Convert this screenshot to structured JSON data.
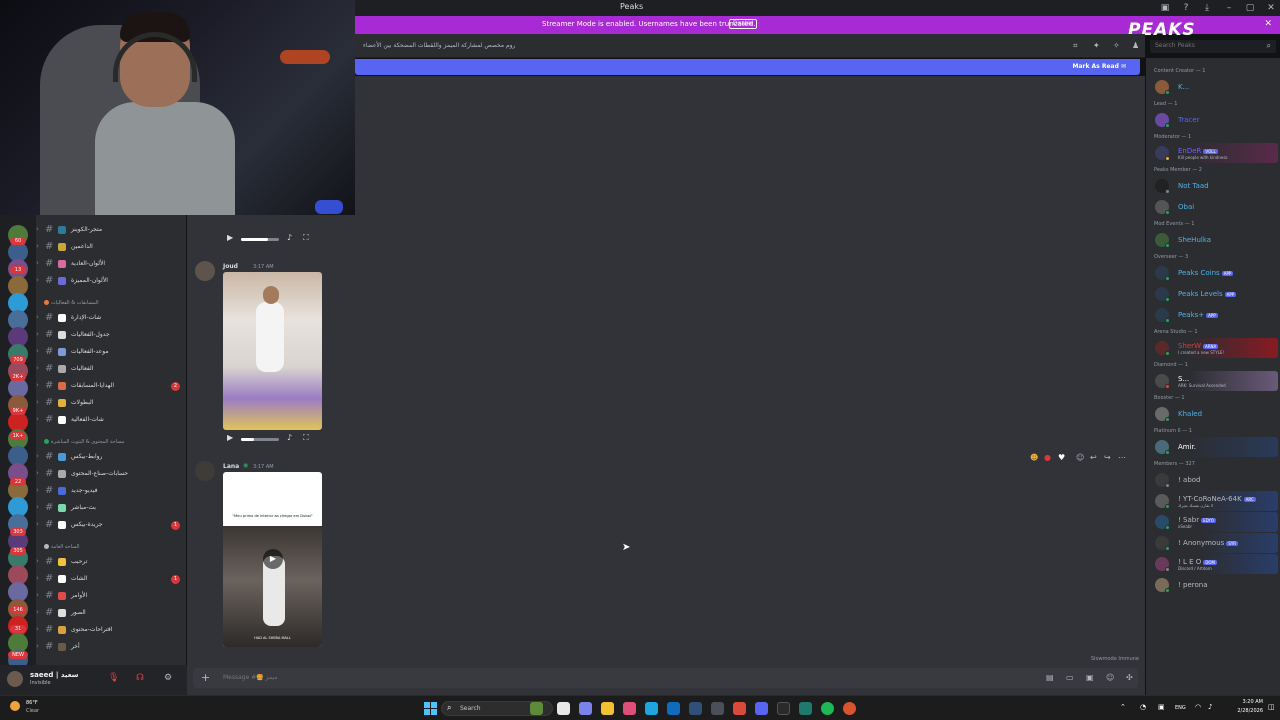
{
  "window": {
    "title": "Peaks",
    "controls": [
      "minimize-icon",
      "maximize-icon",
      "close-icon"
    ]
  },
  "streamer_banner": {
    "text": "Streamer Mode is enabled. Usernames have been truncated.",
    "disable_label": "Disable",
    "color": "#a82ad4"
  },
  "brand": {
    "logo_text": "PEAKS"
  },
  "channel_header": {
    "topic": "روم مخصص لمشاركة الميمز واللقطات المضحكة بين الأعضاء",
    "search_placeholder": "Search Peaks"
  },
  "unread_bar": {
    "label": "Mark As Read",
    "color": "#5865f2"
  },
  "channel_sidebar": {
    "categories": [
      {
        "label": "المسابقات & الفعاليات",
        "color": "#f0783c"
      },
      {
        "label": "مساحة المحتوى & البثوث المباشرة",
        "color": "#23a55a"
      },
      {
        "label": "الساحة العامة",
        "color": "#b5bac1"
      }
    ],
    "channels": [
      {
        "name": "متجر-الكوينز",
        "badge": ""
      },
      {
        "name": "الداعمين",
        "badge": ""
      },
      {
        "name": "الألوان-العادية",
        "badge": ""
      },
      {
        "name": "الألوان-المميزة",
        "badge": ""
      },
      {
        "name": "شات-الإدارة",
        "badge": ""
      },
      {
        "name": "جدول-الفعاليات",
        "badge": ""
      },
      {
        "name": "موعد-الفعاليات",
        "badge": ""
      },
      {
        "name": "الفعاليات",
        "badge": ""
      },
      {
        "name": "الهدايا-المسابقات",
        "badge": "2"
      },
      {
        "name": "البطولات",
        "badge": ""
      },
      {
        "name": "شات-الفعالية",
        "badge": ""
      },
      {
        "name": "روابط-بيكس",
        "badge": ""
      },
      {
        "name": "حسابات-صناع-المحتوى",
        "badge": ""
      },
      {
        "name": "فيديو-جديد",
        "badge": ""
      },
      {
        "name": "بث-مباشر",
        "badge": ""
      },
      {
        "name": "جريدة-بيكس",
        "badge": "1"
      },
      {
        "name": "ترحيب",
        "badge": ""
      },
      {
        "name": "الشات",
        "badge": "1"
      },
      {
        "name": "الأوامر",
        "badge": ""
      },
      {
        "name": "الصور",
        "badge": ""
      },
      {
        "name": "اقتراحات-محتوى",
        "badge": ""
      },
      {
        "name": "أخر",
        "badge": ""
      }
    ],
    "server_badges": [
      "60",
      "13",
      "709",
      "2K+",
      "9K+",
      "1K+",
      "22",
      "303",
      "305",
      "146",
      "31",
      "NEW"
    ]
  },
  "user_panel": {
    "name": "saeed | سعيد",
    "status": "Invisible"
  },
  "messages": [
    {
      "author": "Joud",
      "time": "3:17 AM",
      "author_color": "#dbdee1"
    },
    {
      "author": "Lana",
      "time": "3:17 AM",
      "author_color": "#dbdee1",
      "video_caption": "\"Meu primo de interior ao chegar em Dubai\"",
      "video_watermark": "HAD AL SHEBA MALL"
    }
  ],
  "message_input": {
    "placeholder": "Message #🍔 ميمز",
    "slowmode": "Slowmode Immune"
  },
  "member_list": {
    "groups": [
      {
        "role": "Content Creator — 1",
        "members": [
          {
            "name": "K...",
            "color": "#4fb2e8",
            "tag": "",
            "sub": ""
          }
        ]
      },
      {
        "role": "Lead — 1",
        "members": [
          {
            "name": "Tracer",
            "color": "#5865f2",
            "tag": "",
            "sub": ""
          }
        ]
      },
      {
        "role": "Moderator — 1",
        "members": [
          {
            "name": "EnDeR",
            "color": "#7c5cff",
            "tag": "VOLL",
            "sub": "Kill people with kindness"
          }
        ]
      },
      {
        "role": "Peaks Member — 2",
        "members": [
          {
            "name": "Not Taad",
            "color": "#4fb2e8",
            "tag": "",
            "sub": ""
          },
          {
            "name": "Obai",
            "color": "#4fb2e8",
            "tag": "",
            "sub": ""
          }
        ]
      },
      {
        "role": "Mod Events — 1",
        "members": [
          {
            "name": "SheHulka",
            "color": "#4fb2e8",
            "tag": "",
            "sub": ""
          }
        ]
      },
      {
        "role": "Overseer — 3",
        "members": [
          {
            "name": "Peaks Coins",
            "color": "#4fb2e8",
            "tag": "APP",
            "sub": ""
          },
          {
            "name": "Peaks Levels",
            "color": "#4fb2e8",
            "tag": "APP",
            "sub": ""
          },
          {
            "name": "Peaks+",
            "color": "#4fb2e8",
            "tag": "APP",
            "sub": ""
          }
        ]
      },
      {
        "role": "Arena Studio — 1",
        "members": [
          {
            "name": "SherW",
            "color": "#e3363f",
            "tag": "ARNA",
            "sub": "I created a new STYLE!"
          }
        ]
      },
      {
        "role": "Diamond — 1",
        "members": [
          {
            "name": "S...",
            "color": "#ffffff",
            "tag": "",
            "sub": "ARK: Survival Ascended"
          }
        ]
      },
      {
        "role": "Booster — 1",
        "members": [
          {
            "name": "Khaled",
            "color": "#4fb2e8",
            "tag": "",
            "sub": ""
          }
        ]
      },
      {
        "role": "Platinum II — 1",
        "members": [
          {
            "name": "Amir.",
            "color": "#ffffff",
            "tag": "",
            "sub": ""
          }
        ]
      },
      {
        "role": "Members — 327",
        "members": [
          {
            "name": "! abod",
            "color": "#b5bac1",
            "tag": "",
            "sub": ""
          },
          {
            "name": "! YT-CoRoNeA-64K",
            "color": "#b5bac1",
            "tag": "ARC",
            "sub": "لا تقارن نفسك بغيرك"
          },
          {
            "name": "! Sabr",
            "color": "#b5bac1",
            "tag": "EDYO",
            "sub": "xSeabr"
          },
          {
            "name": "! Anonymous",
            "color": "#b5bac1",
            "tag": "SYR",
            "sub": ""
          },
          {
            "name": "! L E O",
            "color": "#b5bac1",
            "tag": "DOM",
            "sub": "Discord / Artdom"
          },
          {
            "name": "! perona",
            "color": "#b5bac1",
            "tag": "",
            "sub": ""
          }
        ]
      }
    ]
  },
  "taskbar": {
    "weather_temp": "86°F",
    "weather_desc": "Clear",
    "search_label": "Search",
    "tray_lang": "ENG",
    "time": "3:20 AM",
    "date": "2/28/2026"
  }
}
